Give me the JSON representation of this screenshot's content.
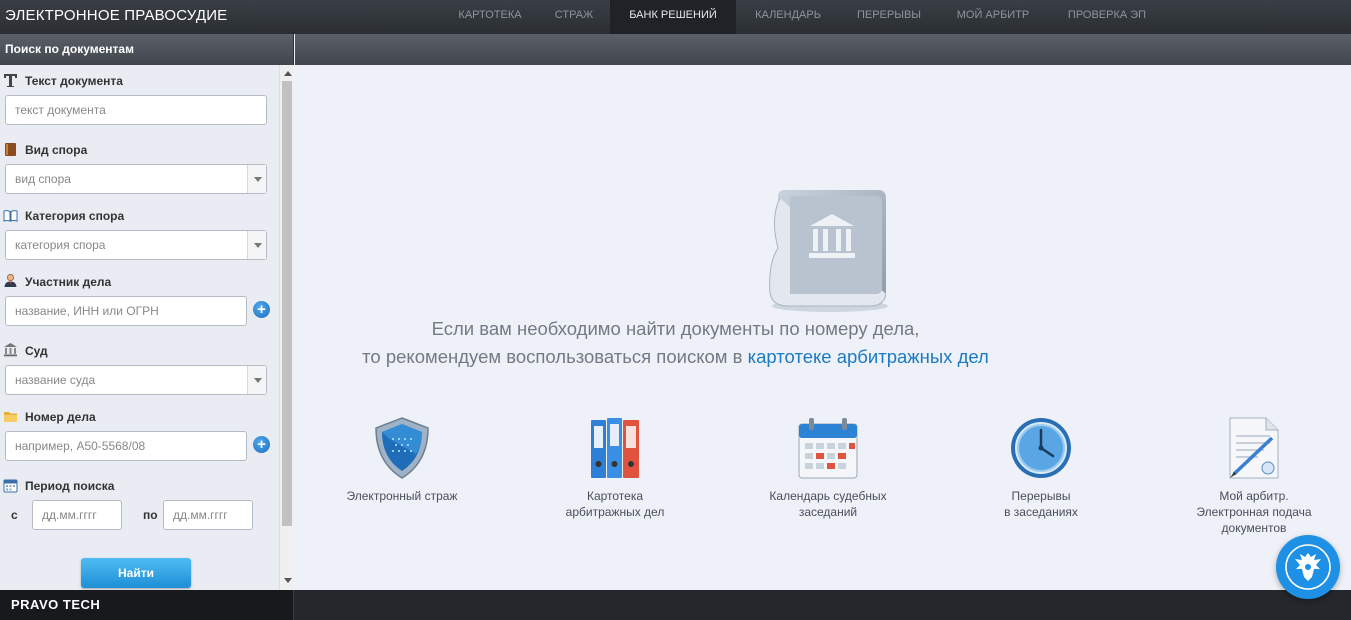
{
  "app": {
    "title": "ЭЛЕКТРОННОЕ ПРАВОСУДИЕ"
  },
  "nav": [
    {
      "label": "КАРТОТЕКА",
      "active": false
    },
    {
      "label": "СТРАЖ",
      "active": false
    },
    {
      "label": "БАНК РЕШЕНИЙ",
      "active": true
    },
    {
      "label": "КАЛЕНДАРЬ",
      "active": false
    },
    {
      "label": "ПЕРЕРЫВЫ",
      "active": false
    },
    {
      "label": "МОЙ АРБИТР",
      "active": false
    },
    {
      "label": "ПРОВЕРКА ЭП",
      "active": false
    }
  ],
  "search_panel": {
    "title": "Поиск по документам",
    "doc_text": {
      "label": "Текст документа",
      "placeholder": "текст документа",
      "icon": "text-t-icon"
    },
    "dispute_type": {
      "label": "Вид спора",
      "placeholder": "вид спора",
      "icon": "book-icon"
    },
    "dispute_category": {
      "label": "Категория спора",
      "placeholder": "категория спора",
      "icon": "open-book-icon"
    },
    "participant": {
      "label": "Участник дела",
      "placeholder": "название, ИНН или ОГРН",
      "icon": "person-icon"
    },
    "court": {
      "label": "Суд",
      "placeholder": "название суда",
      "icon": "courthouse-icon"
    },
    "case_number": {
      "label": "Номер дела",
      "placeholder": "например, А50-5568/08",
      "icon": "folder-icon"
    },
    "period": {
      "label": "Период поиска",
      "from_label": "с",
      "to_label": "по",
      "from_placeholder": "дд.мм.гггг",
      "to_placeholder": "дд.мм.гггг",
      "icon": "calendar-icon"
    },
    "search_button": "Найти"
  },
  "main": {
    "hero_line1": "Если вам необходимо найти документы по номеру дела,",
    "hero_line2_prefix": "то рекомендуем воспользоваться поиском в ",
    "hero_link": "картотеке арбитражных дел",
    "services": [
      {
        "line1": "Электронный страж",
        "line2": "",
        "line3": "",
        "icon": "shield-icon"
      },
      {
        "line1": "Картотека",
        "line2": "арбитражных дел",
        "line3": "",
        "icon": "binders-icon"
      },
      {
        "line1": "Календарь судебных",
        "line2": "заседаний",
        "line3": "",
        "icon": "calendar-icon"
      },
      {
        "line1": "Перерывы",
        "line2": "в заседаниях",
        "line3": "",
        "icon": "clock-icon"
      },
      {
        "line1": "Мой арбитр.",
        "line2": "Электронная подача",
        "line3": "документов",
        "icon": "document-pen-icon"
      }
    ]
  },
  "footer": {
    "brand": "PRAVO TECH"
  },
  "colors": {
    "accent": "#1e90e6",
    "link": "#1b7ac4",
    "topbar": "#2a2e33"
  }
}
